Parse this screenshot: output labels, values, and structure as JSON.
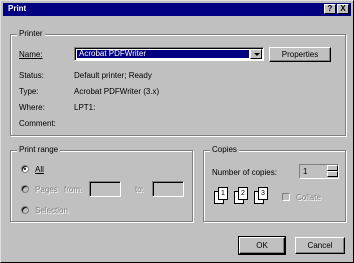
{
  "window": {
    "title": "Print",
    "help_label": "?",
    "close_label": "X"
  },
  "printer": {
    "group_label": "Printer",
    "name_label": "Name:",
    "name_value": "Acrobat PDFWriter",
    "properties_label": "Properties",
    "status_label": "Status:",
    "status_value": "Default printer; Ready",
    "type_label": "Type:",
    "type_value": "Acrobat PDFWriter (3.x)",
    "where_label": "Where:",
    "where_value": "LPT1:",
    "comment_label": "Comment:"
  },
  "print_range": {
    "group_label": "Print range",
    "all_label": "All",
    "pages_label": "Pages",
    "from_label": "from:",
    "to_label": "to:",
    "selection_label": "Selection",
    "selected": "all"
  },
  "copies": {
    "group_label": "Copies",
    "number_label": "Number of copies:",
    "number_value": "1",
    "collate_label": "Collate",
    "collate_icon_pages": [
      "1",
      "2",
      "3"
    ]
  },
  "buttons": {
    "ok_label": "OK",
    "cancel_label": "Cancel"
  },
  "colors": {
    "titlebar": "#000080",
    "face": "#c0c0c0",
    "selection": "#000080"
  }
}
